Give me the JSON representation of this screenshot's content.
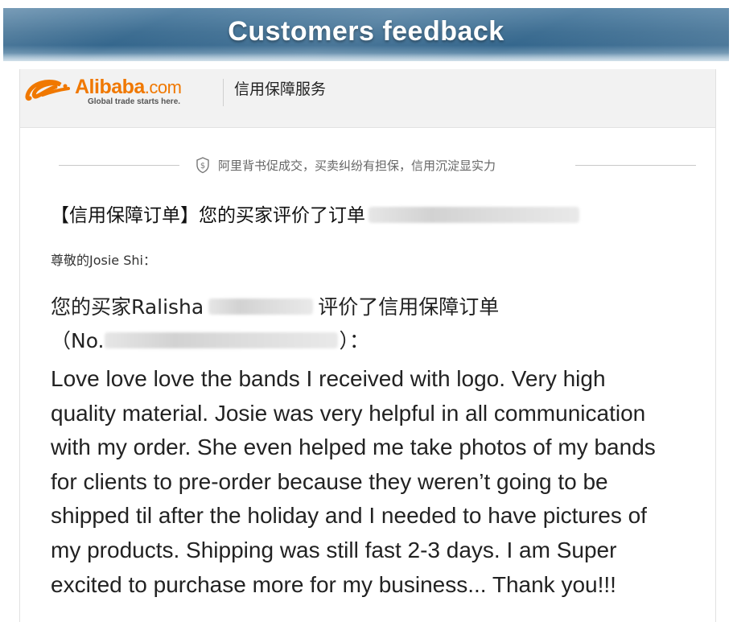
{
  "banner": {
    "title": "Customers feedback"
  },
  "header": {
    "logo_brand": "Alibaba",
    "logo_suffix": ".com",
    "logo_tagline": "Global trade starts here.",
    "logo_icon": "alibaba-logo-icon",
    "service_name": "信用保障服务"
  },
  "slogan": {
    "icon": "shield-dollar-icon",
    "text": "阿里背书促成交，买卖纠纷有担保，信用沉淀显实力"
  },
  "email": {
    "subject": "【信用保障订单】您的买家评价了订单",
    "greeting": "尊敬的Josie Shi：",
    "buyer_prefix": "您的买家Ralisha",
    "buyer_suffix": "评价了信用保障订单",
    "order_prefix": "（No.",
    "order_suffix": "）：",
    "review_lines": [
      "Love love love the bands I received with logo. Very high",
      "quality material. Josie was very helpful in all communication",
      "with my order. She even helped me take photos of my bands",
      "for clients to pre-order because they weren’t going to be",
      "shipped til after the holiday and I needed to have pictures of",
      "my products. Shipping was still fast 2-3 days. I am Super",
      "excited to purchase more for my business... Thank you!!!"
    ]
  },
  "colors": {
    "brand_orange": "#f07800",
    "banner_blue": "#3f6f93"
  }
}
